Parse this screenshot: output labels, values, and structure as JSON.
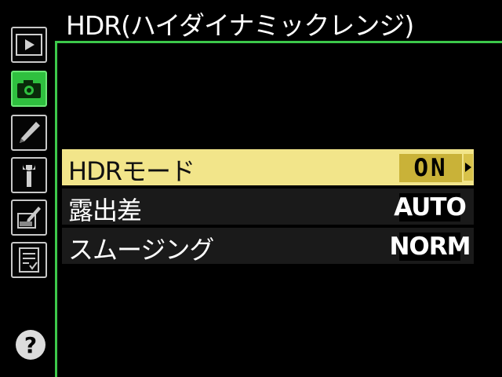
{
  "title": "HDR(ハイダイナミックレンジ)",
  "tabs": [
    {
      "name": "playback",
      "icon": "play-icon",
      "active": false
    },
    {
      "name": "shooting",
      "icon": "camera-icon",
      "active": true
    },
    {
      "name": "custom-settings",
      "icon": "pencil-icon",
      "active": false
    },
    {
      "name": "setup",
      "icon": "wrench-icon",
      "active": false
    },
    {
      "name": "retouch",
      "icon": "retouch-brush-icon",
      "active": false
    },
    {
      "name": "my-menu",
      "icon": "checklist-icon",
      "active": false
    }
  ],
  "help_label": "?",
  "menu": {
    "items": [
      {
        "label": "HDRモード",
        "value": "ON",
        "selected": true,
        "arrow": "▶"
      },
      {
        "label": "露出差",
        "value": "AUTO",
        "selected": false
      },
      {
        "label": "スムージング",
        "value": "NORM",
        "selected": false
      }
    ]
  },
  "colors": {
    "accent_green": "#3cc84a",
    "highlight_yellow": "#f2e58a",
    "value_box_gold": "#c9b238",
    "background": "#000000"
  }
}
